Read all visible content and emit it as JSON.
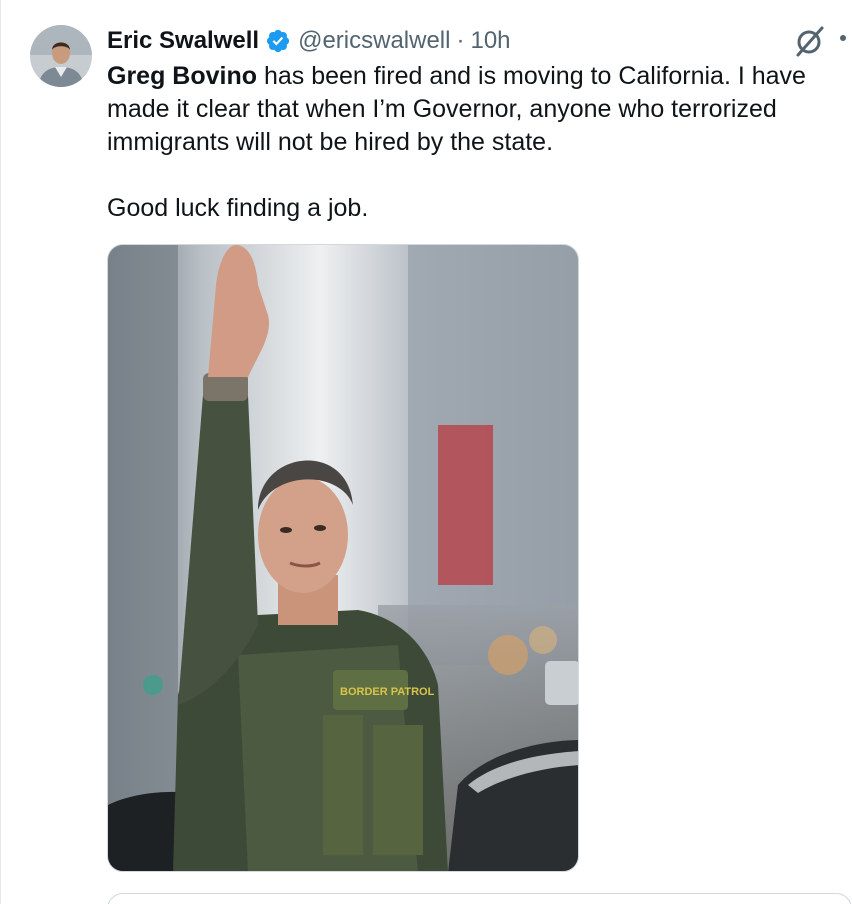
{
  "tweet": {
    "author": {
      "display_name": "Eric Swalwell",
      "handle": "@ericswalwell",
      "separator": "·",
      "time": "10h",
      "verified": true,
      "verified_color": "#1d9bf0"
    },
    "text": {
      "mention": "Greg Bovino",
      "line1_rest": " has been fired and is moving to California.  I have",
      "line2": "made it clear that when I’m Governor, anyone who terrorized",
      "line3": "immigrants will not be hired by the state.",
      "line4": "Good luck finding a job."
    },
    "icons": {
      "grok": "grok-icon",
      "more": "more-icon",
      "verified": "verified-badge-icon"
    }
  }
}
